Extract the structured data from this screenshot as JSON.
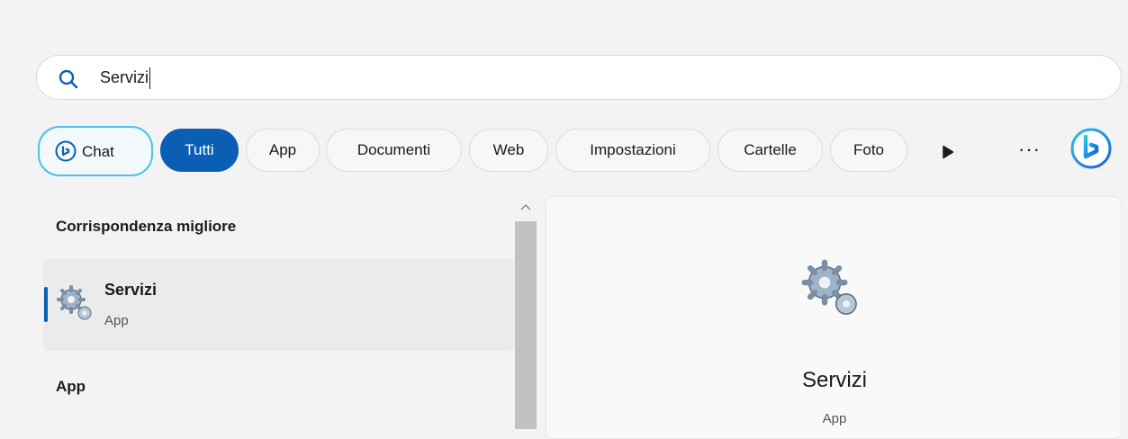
{
  "search": {
    "query": "Servizi"
  },
  "filters": [
    {
      "label": "Chat"
    },
    {
      "label": "Tutti",
      "active": true
    },
    {
      "label": "App"
    },
    {
      "label": "Documenti"
    },
    {
      "label": "Web"
    },
    {
      "label": "Impostazioni"
    },
    {
      "label": "Cartelle"
    },
    {
      "label": "Foto"
    }
  ],
  "icons": {
    "search": "search-icon",
    "chat": "bing-chat-icon",
    "play": "play-icon",
    "more": "more-icon",
    "copilot": "bing-copilot-icon",
    "app": "services-gears-icon"
  },
  "colors": {
    "accent": "#0a5fb4",
    "chat_border": "#4cc2e6"
  },
  "results": {
    "best_match_title": "Corrispondenza migliore",
    "best_match": {
      "name": "Servizi",
      "type": "App"
    },
    "apps_title": "App"
  },
  "preview": {
    "name": "Servizi",
    "type": "App"
  }
}
